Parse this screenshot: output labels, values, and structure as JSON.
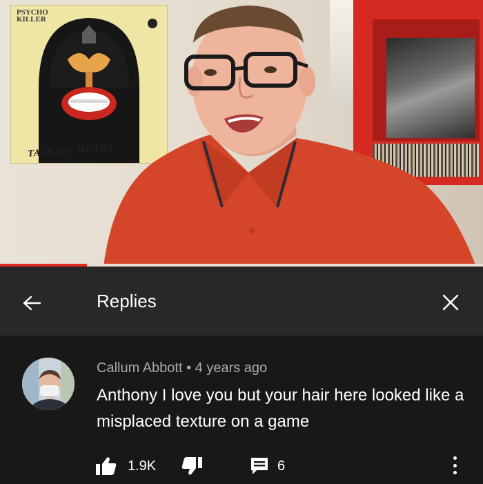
{
  "video": {
    "poster_title": "PSYCHO KILLER",
    "poster_band": "TALKING HEADS",
    "progress_percent": 18,
    "progress_color": "#e02b20"
  },
  "header": {
    "back_icon": "arrow-left-icon",
    "title": "Replies",
    "close_icon": "close-icon"
  },
  "comment": {
    "avatar_icon": "user-avatar",
    "author": "Callum Abbott",
    "separator": "•",
    "time": "4 years ago",
    "text": "Anthony I love you but your hair here looked like a misplaced texture on a game",
    "like_icon": "thumbs-up-icon",
    "likes": "1.9K",
    "dislike_icon": "thumbs-down-icon",
    "reply_icon": "comment-icon",
    "replies": "6",
    "more_icon": "more-vertical-icon"
  },
  "colors": {
    "background": "#181818",
    "header_background": "#282828",
    "text_primary": "#ffffff",
    "text_secondary": "#aaaaaa"
  }
}
